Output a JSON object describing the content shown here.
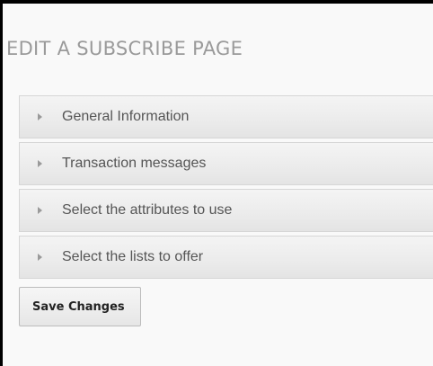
{
  "page": {
    "title": "EDIT A SUBSCRIBE PAGE"
  },
  "accordion": {
    "items": [
      {
        "label": "General Information",
        "icon": "triangle-right-icon"
      },
      {
        "label": "Transaction messages",
        "icon": "triangle-right-icon"
      },
      {
        "label": "Select the attributes to use",
        "icon": "triangle-right-icon"
      },
      {
        "label": "Select the lists to offer",
        "icon": "triangle-right-icon"
      }
    ]
  },
  "actions": {
    "save_label": "Save Changes"
  }
}
